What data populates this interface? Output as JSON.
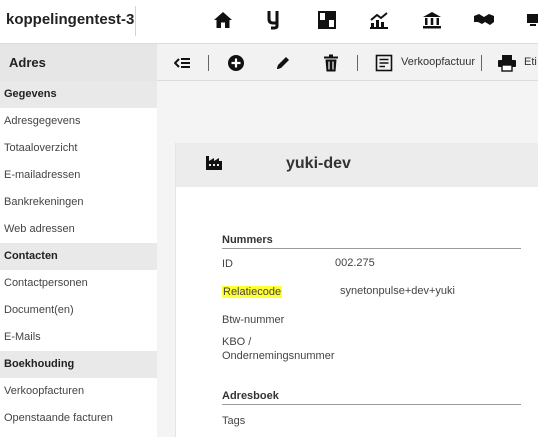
{
  "header": {
    "app_title": "koppelingentest-3",
    "nav_icons": [
      "home-icon",
      "yuki-logo-icon",
      "modules-icon",
      "chart-icon",
      "bank-icon",
      "handshake-icon",
      "device-icon"
    ]
  },
  "toolbar": {
    "section_label": "Adres",
    "buttons": [
      "collapse-list-icon",
      "add-icon",
      "edit-icon",
      "delete-icon"
    ],
    "sales_invoice_label": "Verkoopfactuur",
    "print_label": "Eti"
  },
  "sidebar": {
    "sections": [
      {
        "title": "Gegevens",
        "items": [
          "Adresgegevens",
          "Totaaloverzicht",
          "E-mailadressen",
          "Bankrekeningen",
          "Web adressen"
        ]
      },
      {
        "title": "Contacten",
        "items": [
          "Contactpersonen",
          "Document(en)",
          "E-Mails"
        ]
      },
      {
        "title": "Boekhouding",
        "items": [
          "Verkoopfacturen",
          "Openstaande facturen"
        ]
      }
    ]
  },
  "card": {
    "title": "yuki-dev",
    "icon": "factory-icon",
    "nummers": {
      "title": "Nummers",
      "id_label": "ID",
      "id_value": "002.275",
      "relatiecode_label": "Relatiecode",
      "relatiecode_value": "synetonpulse+dev+yuki",
      "btw_label": "Btw-nummer",
      "kbo_label_1": "KBO /",
      "kbo_label_2": "Ondernemingsnummer"
    },
    "adresboek": {
      "title": "Adresboek",
      "tags_label": "Tags"
    }
  },
  "colors": {
    "highlight": "#ffff33",
    "sidebar_section": "#e9e9e9",
    "card_header": "#ececec"
  }
}
